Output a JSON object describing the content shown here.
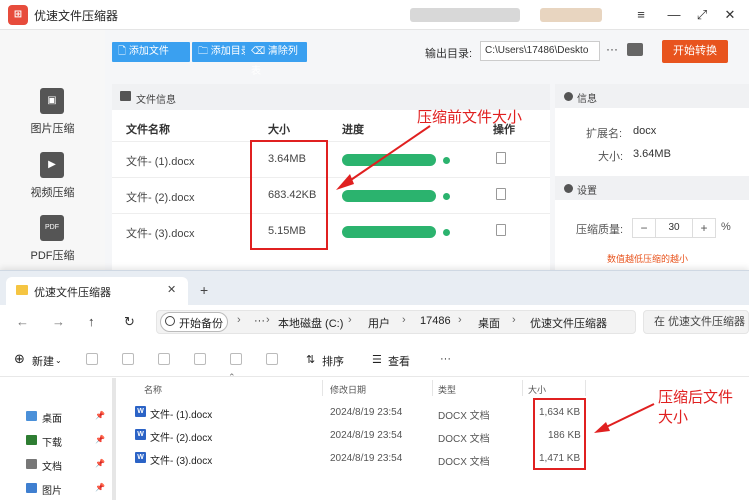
{
  "app": {
    "title": "优速文件压缩器",
    "window_controls": [
      "≡",
      "—",
      "⤢",
      "✕"
    ],
    "sidebar": [
      {
        "label": "图片压缩",
        "icon": "image-icon"
      },
      {
        "label": "视频压缩",
        "icon": "video-icon"
      },
      {
        "label": "PDF压缩",
        "icon": "pdf-icon",
        "icon_text": "PDF"
      }
    ],
    "toolbar": {
      "add_file": "添加文件",
      "add_dir": "添加目录",
      "clear_list": "清除列表",
      "output_label": "输出目录:",
      "output_path": "C:\\Users\\17486\\Deskto",
      "more": "···",
      "start": "开始转换"
    },
    "file_panel": {
      "title": "文件信息",
      "columns": [
        "文件名称",
        "大小",
        "进度",
        "操作"
      ],
      "rows": [
        {
          "name": "文件- (1).docx",
          "size": "3.64MB",
          "progress": 1.0
        },
        {
          "name": "文件- (2).docx",
          "size": "683.42KB",
          "progress": 1.0
        },
        {
          "name": "文件- (3).docx",
          "size": "5.15MB",
          "progress": 1.0
        }
      ]
    },
    "info_panel": {
      "title": "信息",
      "ext_label": "扩展名:",
      "ext_value": "docx",
      "size_label": "大小:",
      "size_value": "3.64MB",
      "settings_title": "设置",
      "quality_label": "压缩质量:",
      "quality_minus": "−",
      "quality_value": "30",
      "quality_plus": "+",
      "quality_unit": "%",
      "hint": "数值越低压缩的越小"
    }
  },
  "annotations": {
    "before": "压缩前文件大小",
    "after_line1": "压缩后文件",
    "after_line2": "大小"
  },
  "explorer": {
    "tab_label": "优速文件压缩器",
    "tab_close": "✕",
    "tab_new": "+",
    "nav": {
      "back": "←",
      "forward": "→",
      "up": "↑",
      "refresh": "↻"
    },
    "breadcrumb": {
      "backup": "开始备份",
      "more": "···",
      "items": [
        "本地磁盘 (C:)",
        "用户",
        "17486",
        "桌面",
        "优速文件压缩器"
      ]
    },
    "search_placeholder": "在 优速文件压缩器 中",
    "commands": {
      "new": "新建",
      "sort": "排序",
      "view": "查看",
      "more": "···"
    },
    "nav_items": [
      "桌面",
      "下载",
      "文档",
      "图片"
    ],
    "columns": [
      "名称",
      "修改日期",
      "类型",
      "大小"
    ],
    "files": [
      {
        "name": "文件- (1).docx",
        "date": "2024/8/19 23:54",
        "type": "DOCX 文档",
        "size": "1,634 KB"
      },
      {
        "name": "文件- (2).docx",
        "date": "2024/8/19 23:54",
        "type": "DOCX 文档",
        "size": "186 KB"
      },
      {
        "name": "文件- (3).docx",
        "date": "2024/8/19 23:54",
        "type": "DOCX 文档",
        "size": "1,471 KB"
      }
    ]
  },
  "colors": {
    "accent": "#3aa0f0",
    "start": "#e8541e",
    "progress": "#2bb36e",
    "annotation": "#e02020"
  }
}
